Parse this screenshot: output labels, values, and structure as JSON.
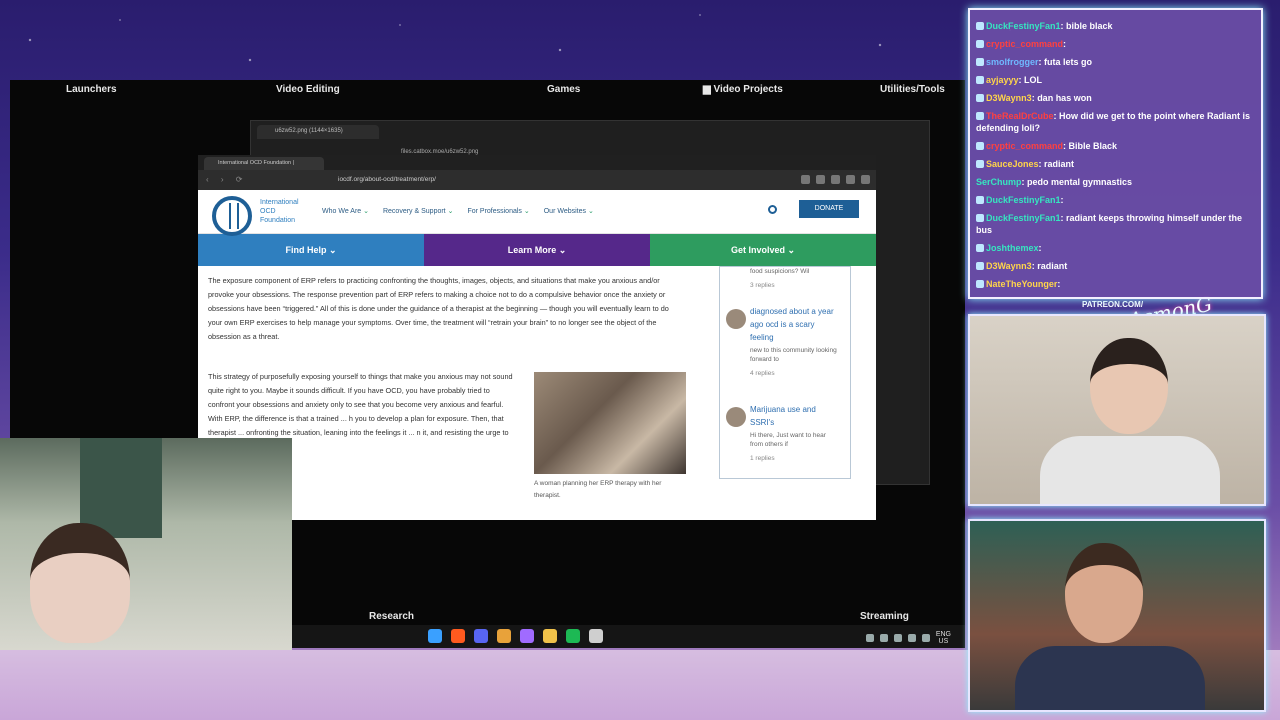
{
  "desktop": {
    "labels": {
      "launchers": "Launchers",
      "video_editing": "Video Editing",
      "games": "Games",
      "video_projects": "Video Projects",
      "utilities": "Utilities/Tools",
      "research": "Research",
      "streaming": "Streaming"
    },
    "tray_lang": "ENG",
    "tray_region": "US"
  },
  "back_browser": {
    "tab_title": "u6zw52.png (1144×1635)",
    "url": "files.catbox.moe/u6zw52.png"
  },
  "front_browser": {
    "tab_title": "International OCD Foundation | ",
    "url": "iocdf.org/about-ocd/treatment/erp/"
  },
  "site": {
    "logo_text": "International OCD Foundation",
    "nav": [
      "Who We Are",
      "Recovery & Support",
      "For Professionals",
      "Our Websites"
    ],
    "donate": "DONATE",
    "menu": {
      "find_help": "Find Help",
      "learn_more": "Learn More",
      "get_involved": "Get Involved"
    },
    "paragraph1": "The exposure component of ERP refers to practicing confronting the thoughts, images, objects, and situations that make you anxious and/or provoke your obsessions. The response prevention part of ERP refers to making a choice not to do a compulsive behavior once the anxiety or obsessions have been “triggered.” All of this is done under the guidance of a therapist at the beginning — though you will eventually learn to do your own ERP exercises to help manage your symptoms. Over time, the treatment will “retrain your brain” to no longer see the object of the obsession as a threat.",
    "paragraph2": "This strategy of purposefully exposing yourself to things that make you anxious may not sound quite right to you. Maybe it sounds difficult. If you have OCD, you have probably tried to confront your obsessions and anxiety only to see that you become very anxious and fearful. With ERP, the difference is that a trained ... h you to develop a plan for exposure. Then, that therapist ... onfronting the situation, leaning into the feelings it ... n it, and resisting the urge to engage in compulsive",
    "photo_caption": "A woman planning her ERP therapy with her therapist.",
    "forum": [
      {
        "title": "food suspicions? Wil",
        "desc": "",
        "replies": "3 replies"
      },
      {
        "title": "diagnosed about a year ago ocd is a scary feeling",
        "desc": "new to this community looking forward to",
        "replies": "4 replies"
      },
      {
        "title": "Marijuana use and SSRI's",
        "desc": "Hi there, Just want to hear from others if",
        "replies": "1 replies"
      }
    ]
  },
  "overlay": {
    "patreon": "PATREON.COM/",
    "signature": "AsmonG"
  },
  "chat": [
    {
      "user": "DuckFestinyFan1",
      "color": "teal",
      "text": "bible black"
    },
    {
      "user": "cryptic_command",
      "color": "red",
      "text": ""
    },
    {
      "user": "smolfrogger",
      "color": "blue",
      "text": "futa lets go"
    },
    {
      "user": "ayjayyy",
      "color": "yellow",
      "text": "LOL"
    },
    {
      "user": "D3Waynn3",
      "color": "yellow",
      "text": "dan has won"
    },
    {
      "user": "TheRealDrCube",
      "color": "red",
      "text": "How did we get to the point where Radiant is defending loli?"
    },
    {
      "user": "cryptic_command",
      "color": "red",
      "text": "Bible Black"
    },
    {
      "user": "SauceJones",
      "color": "yellow",
      "text": "radiant"
    },
    {
      "user": "SerChump",
      "color": "teal",
      "text": "pedo mental gymnastics"
    },
    {
      "user": "DuckFestinyFan1",
      "color": "teal",
      "text": ""
    },
    {
      "user": "DuckFestinyFan1",
      "color": "teal",
      "text": "radiant keeps throwing himself under the bus"
    },
    {
      "user": "Joshthemex",
      "color": "teal",
      "text": ""
    },
    {
      "user": "D3Waynn3",
      "color": "yellow",
      "text": "radiant"
    },
    {
      "user": "NateTheYounger",
      "color": "yellow",
      "text": ""
    }
  ],
  "colors": {
    "accent_blue": "#1e5f96",
    "find_help": "#2f7fbf",
    "learn_more": "#55288a",
    "get_involved": "#2e9c5f",
    "chat_bg": "#6a4ea6"
  }
}
